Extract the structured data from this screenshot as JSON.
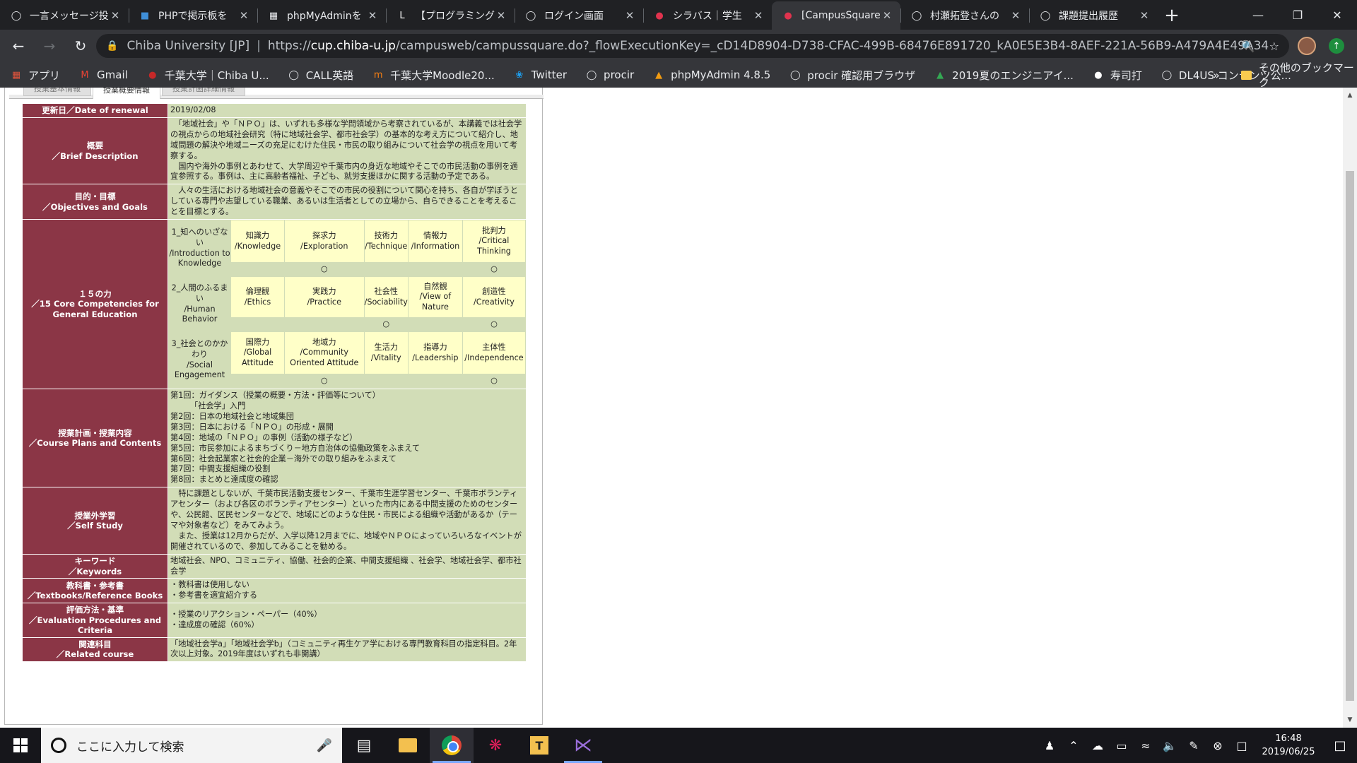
{
  "browser": {
    "tabs": [
      {
        "title": "一言メッセージ投",
        "icon": "globe-icon"
      },
      {
        "title": "PHPで掲示板を",
        "icon": "page-icon"
      },
      {
        "title": "phpMyAdminを",
        "icon": "grid-icon"
      },
      {
        "title": "【プログラミング",
        "icon": "letter-l-icon"
      },
      {
        "title": "ログイン画面",
        "icon": "globe-icon"
      },
      {
        "title": "シラバス｜学生",
        "icon": "dot-icon"
      },
      {
        "title": "[CampusSquare",
        "icon": "dot-icon",
        "active": true
      },
      {
        "title": "村瀬拓登さんの",
        "icon": "globe-icon"
      },
      {
        "title": "課題提出履歴",
        "icon": "globe-icon"
      }
    ],
    "omnibox": {
      "site_name": "Chiba University [JP]",
      "separator": "|",
      "url_prefix": "https://",
      "url_host": "cup.chiba-u.jp",
      "url_rest": "/campusweb/campussquare.do?_flowExecutionKey=_cD14D8904-D738-CFAC-499B-68476E891720_kA0E5E3B4-8AEF-221A-56B9-A479A4E49A34"
    },
    "bookmarks": [
      {
        "label": "アプリ",
        "icon": "apps-grid-icon"
      },
      {
        "label": "Gmail",
        "icon": "gmail-icon"
      },
      {
        "label": "千葉大学｜Chiba U...",
        "icon": "chiba-icon"
      },
      {
        "label": "CALL英語",
        "icon": "globe-icon"
      },
      {
        "label": "千葉大学Moodle20...",
        "icon": "moodle-icon"
      },
      {
        "label": "Twitter",
        "icon": "twitter-icon"
      },
      {
        "label": "procir",
        "icon": "globe-icon"
      },
      {
        "label": "phpMyAdmin 4.8.5",
        "icon": "phpmyadmin-icon"
      },
      {
        "label": "procir 確認用ブラウザ",
        "icon": "globe-icon"
      },
      {
        "label": "2019夏のエンジニアイ...",
        "icon": "drive-icon"
      },
      {
        "label": "寿司打",
        "icon": "sushi-icon"
      },
      {
        "label": "DL4US コンテンツ公...",
        "icon": "globe-icon"
      }
    ],
    "bookmarks_more": "»",
    "other_bookmarks": "その他のブックマーク"
  },
  "page": {
    "content_tabs": [
      "授業基本情報",
      "授業概要情報",
      "授業計画詳細情報"
    ],
    "rows": {
      "renewal": {
        "label": "更新日／Date of renewal",
        "value": "2019/02/08"
      },
      "brief": {
        "label": "概要\n／Brief Description",
        "value": "　「地域社会」や「ＮＰＯ」は、いずれも多様な学問領域から考察されているが、本講義では社会学の視点からの地域社会研究（特に地域社会学、都市社会学）の基本的な考え方について紹介し、地域問題の解決や地域ニーズの充足にむけた住民・市民の取り組みについて社会学の視点を用いて考察する。\n　国内や海外の事例とあわせて、大学周辺や千葉市内の身近な地域やそこでの市民活動の事例を適宜参照する。事例は、主に高齢者福祉、子ども、就労支援ほかに関する活動の予定である。"
      },
      "objectives": {
        "label": "目的・目標\n／Objectives and Goals",
        "value": "　人々の生活における地域社会の意義やそこでの市民の役割について関心を持ち、各自が学ぼうとしている専門や志望している職業、あるいは生活者としての立場から、自らできることを考えることを目標とする。"
      },
      "competencies": {
        "label": "１５の力\n／15 Core Competencies for General Education",
        "groups": [
          {
            "name": "1_知へのいざない\n/Introduction to Knowledge",
            "items": [
              "知識力\n/Knowledge",
              "探求力\n/Exploration",
              "技術力\n/Technique",
              "情報力\n/Information",
              "批判力\n/Critical Thinking"
            ],
            "marks": [
              "",
              "○",
              "",
              "",
              "○"
            ]
          },
          {
            "name": "2_人間のふるまい\n/Human Behavior",
            "items": [
              "倫理観\n/Ethics",
              "実践力\n/Practice",
              "社会性\n/Sociability",
              "自然観\n/View of Nature",
              "創造性\n/Creativity"
            ],
            "marks": [
              "",
              "",
              "○",
              "",
              "○"
            ]
          },
          {
            "name": "3_社会とのかかわり\n/Social Engagement",
            "items": [
              "国際力\n/Global Attitude",
              "地域力\n/Community Oriented Attitude",
              "生活力\n/Vitality",
              "指導力\n/Leadership",
              "主体性\n/Independence"
            ],
            "marks": [
              "",
              "○",
              "",
              "",
              "○"
            ]
          }
        ]
      },
      "plans": {
        "label": "授業計画・授業内容\n／Course Plans and Contents",
        "value": "第1回：ガイダンス（授業の概要・方法・評価等について）\n　　　「社会学」入門\n第2回：日本の地域社会と地域集団\n第3回：日本における「ＮＰＯ」の形成・展開\n第4回：地域の「ＮＰＯ」の事例（活動の様子など）\n第5回：市民参加によるまちづくり－地方自治体の協働政策をふまえて\n第6回：社会起業家と社会的企業－海外での取り組みをふまえて\n第7回：中間支援組織の役割\n第8回：まとめと達成度の確認"
      },
      "selfstudy": {
        "label": "授業外学習\n／Self Study",
        "value": "　特に課題としないが、千葉市民活動支援センター、千葉市生涯学習センター、千葉市ボランティアセンター（および各区のボランティアセンター）といった市内にある中間支援のためのセンターや、公民館、区民センターなどで、地域にどのような住民・市民による組織や活動があるか（テーマや対象者など）をみてみよう。\n　また、授業は12月からだが、入学以降12月までに、地域やＮＰＯによっていろいろなイベントが開催されているので、参加してみることを勧める。"
      },
      "keywords": {
        "label": "キーワード\n／Keywords",
        "value": "地域社会、NPO、コミュニティ、協働、社会的企業、中間支援組織 、社会学、地域社会学、都市社会学"
      },
      "textbooks": {
        "label": "教科書・参考書\n／Textbooks/Reference Books",
        "value": "・教科書は使用しない\n・参考書を適宜紹介する"
      },
      "evaluation": {
        "label": "評価方法・基準\n／Evaluation Procedures and Criteria",
        "value": "・授業のリアクション・ペーパー（40%）\n・達成度の確認（60%）"
      },
      "related": {
        "label": "関連科目\n／Related course",
        "value": "「地域社会学a」「地域社会学b」（コミュニティ再生ケア学における専門教育科目の指定科目。2年次以上対象。2019年度はいずれも非開講）"
      }
    }
  },
  "taskbar": {
    "search_placeholder": "ここに入力して検索",
    "time": "16:48",
    "date": "2019/06/25"
  }
}
